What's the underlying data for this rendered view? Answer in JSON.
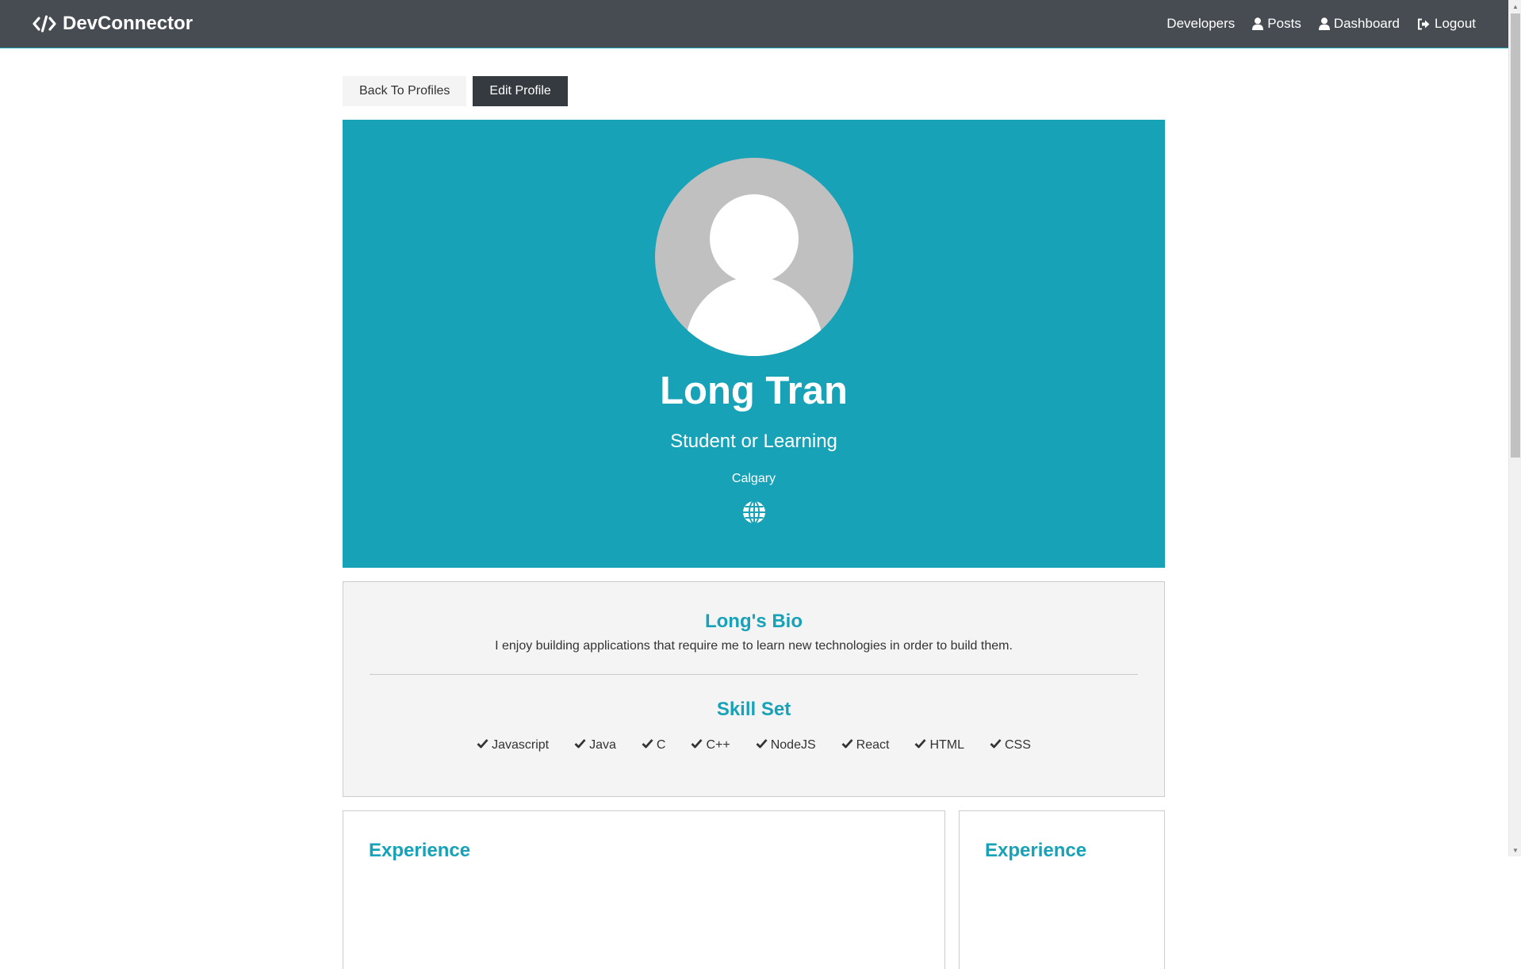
{
  "navbar": {
    "brand": "DevConnector",
    "links": [
      {
        "label": "Developers",
        "icon": "none"
      },
      {
        "label": "Posts",
        "icon": "user-icon"
      },
      {
        "label": "Dashboard",
        "icon": "user-icon"
      },
      {
        "label": "Logout",
        "icon": "sign-out-icon"
      }
    ]
  },
  "buttons": {
    "back": "Back To Profiles",
    "edit": "Edit Profile"
  },
  "profile": {
    "name": "Long Tran",
    "status": "Student or Learning",
    "location": "Calgary",
    "website_icon": "globe-icon"
  },
  "about": {
    "bio_title": "Long's Bio",
    "bio_text": "I enjoy building applications that require me to learn new technologies in order to build them.",
    "skills_title": "Skill Set",
    "skills": [
      "Javascript",
      "Java",
      "C",
      "C++",
      "NodeJS",
      "React",
      "HTML",
      "CSS"
    ]
  },
  "experience": {
    "title": "Experience"
  },
  "education": {
    "title": "Experience"
  },
  "colors": {
    "primary": "#17a2b8",
    "dark": "#343a40",
    "navbar": "#474b52",
    "light": "#f4f4f4"
  }
}
